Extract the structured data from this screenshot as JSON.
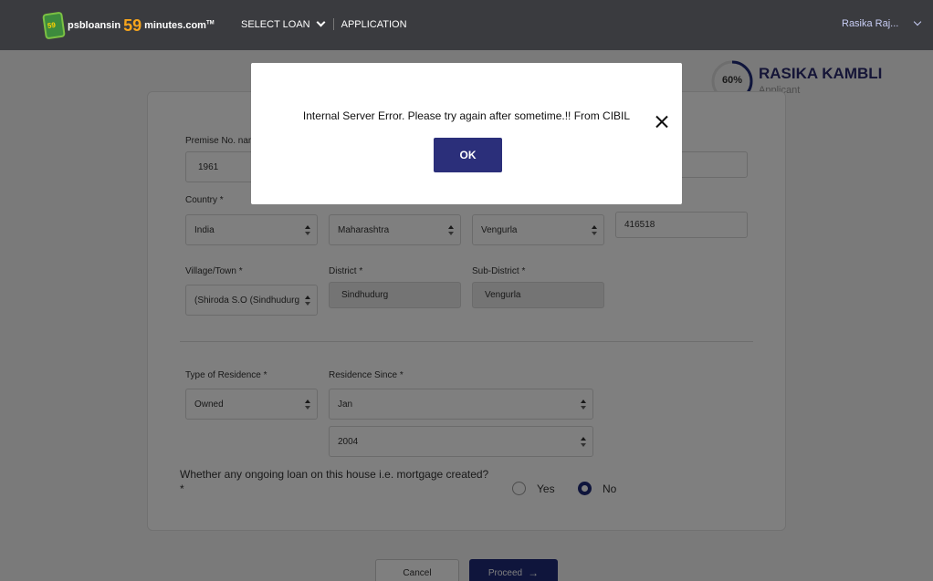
{
  "header": {
    "logo_text": "psbloansin",
    "logo_number": "59",
    "logo_suffix": "minutes.com",
    "logo_tm": "TM",
    "badge_number": "59",
    "nav_select_loan": "SELECT LOAN",
    "nav_application": "APPLICATION",
    "user_name": "Rasika Raj..."
  },
  "applicant": {
    "progress": "60%",
    "progress_value": 0.6,
    "name": "RASIKA KAMBLI",
    "role": "Applicant"
  },
  "form": {
    "premise_label": "Premise No. nam",
    "premise_value": "1961",
    "country_label": "Country *",
    "country_value": "India",
    "state_value": "Maharashtra",
    "city_value": "Vengurla",
    "pincode_value": "416518",
    "village_label": "Village/Town *",
    "village_value": "(Shiroda S.O (Sindhudurg",
    "district_label": "District *",
    "district_value": "Sindhudurg",
    "subdistrict_label": "Sub-District *",
    "subdistrict_value": "Vengurla",
    "residence_type_label": "Type of Residence *",
    "residence_type_value": "Owned",
    "residence_since_label": "Residence Since *",
    "residence_month_value": "Jan",
    "residence_year_value": "2004",
    "mortgage_question": "Whether any ongoing loan on this house i.e. mortgage created?",
    "mortgage_required": "*",
    "option_yes": "Yes",
    "option_no": "No"
  },
  "buttons": {
    "cancel": "Cancel",
    "proceed": "Proceed"
  },
  "modal": {
    "message": "Internal Server Error. Please try again after sometime.!! From CIBIL",
    "ok": "OK"
  },
  "colors": {
    "header_bg": "#3a3b3f",
    "primary": "#1f2a78",
    "logo_orange": "#f7a51c"
  }
}
